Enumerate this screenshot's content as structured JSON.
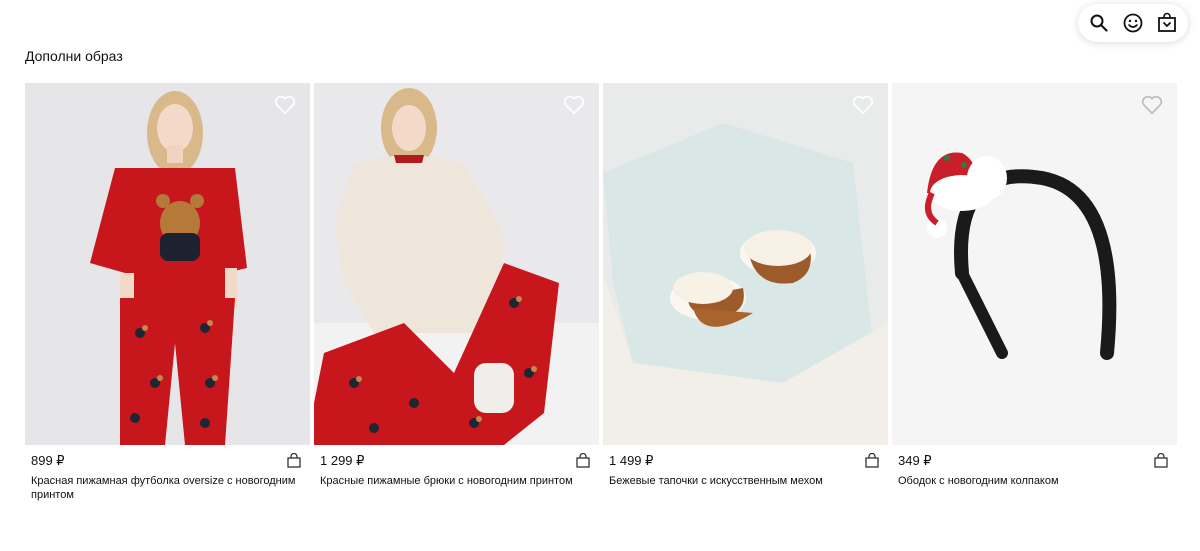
{
  "toolbar": {
    "icons": [
      "search-icon",
      "smile-icon",
      "shopping-bag-icon"
    ]
  },
  "section": {
    "title": "Дополни образ"
  },
  "products": [
    {
      "price": "899 ₽",
      "title": "Красная пижамная футболка oversize с новогодним принтом"
    },
    {
      "price": "1 299 ₽",
      "title": "Красные пижамные брюки с новогодним принтом"
    },
    {
      "price": "1 499 ₽",
      "title": "Бежевые тапочки с искусственным мехом"
    },
    {
      "price": "349 ₽",
      "title": "Ободок с новогодним колпаком"
    }
  ]
}
